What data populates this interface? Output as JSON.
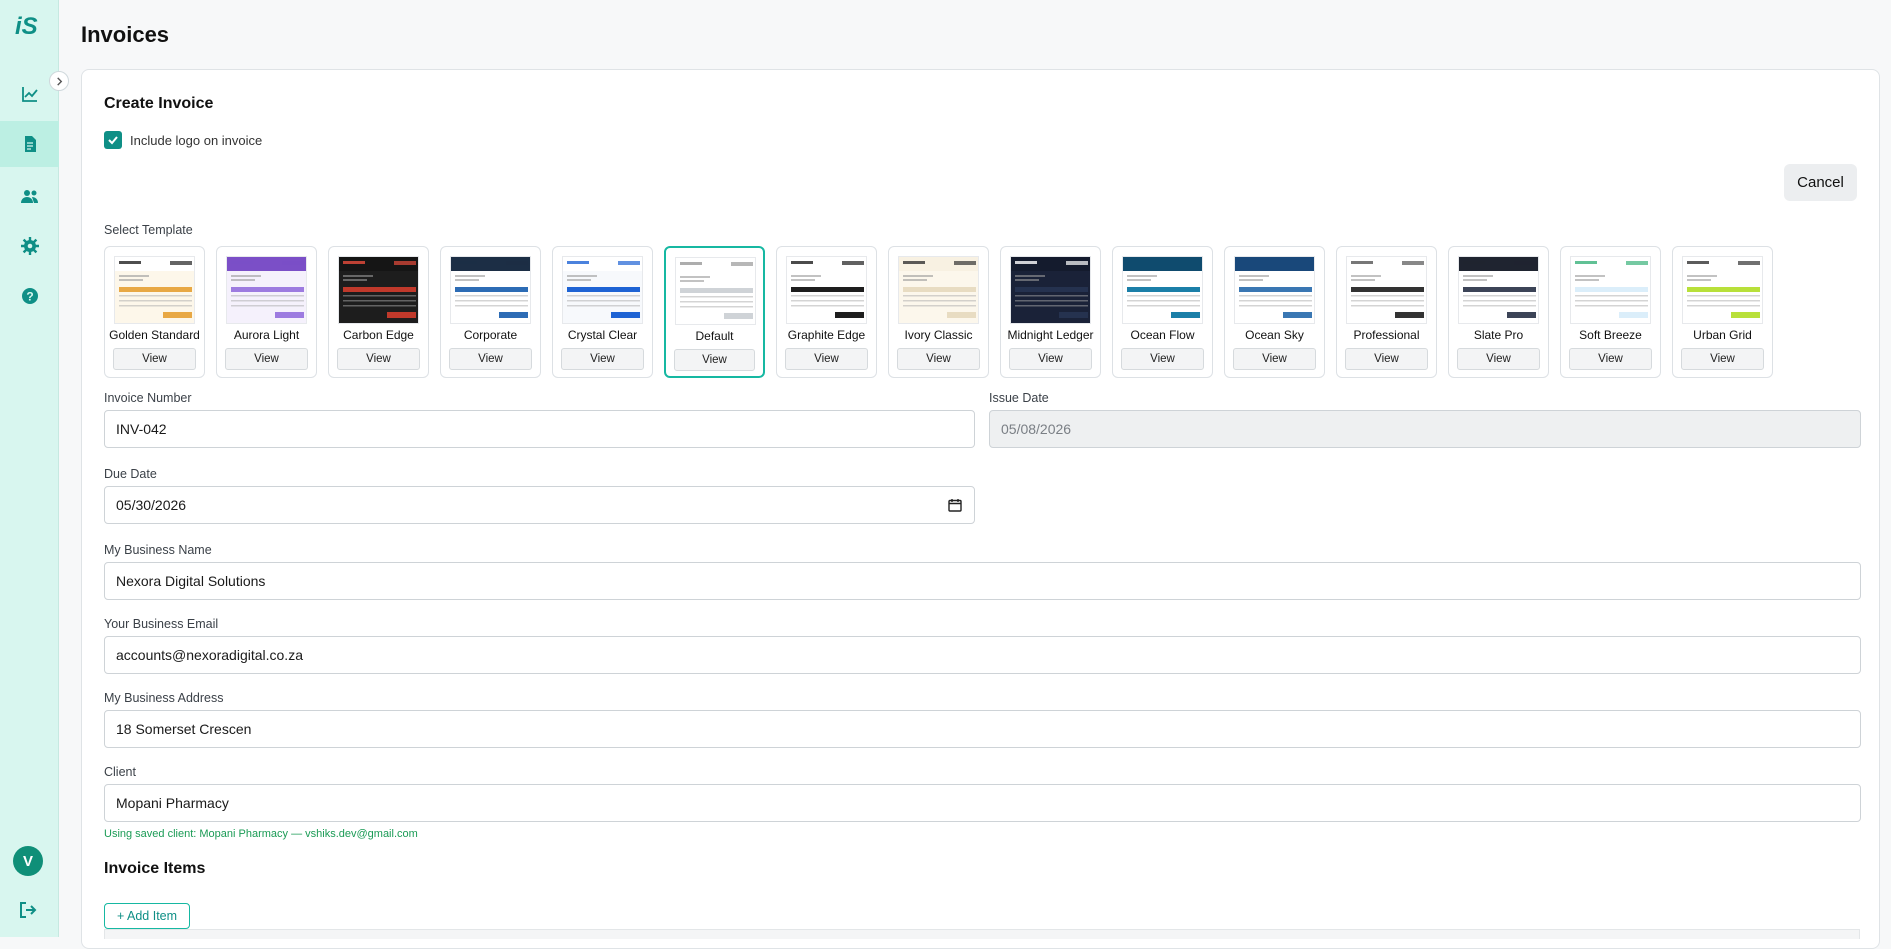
{
  "app": {
    "page_title": "Invoices",
    "logo_text": "iS"
  },
  "sidebar": {
    "icons": [
      "chart-icon",
      "invoice-icon",
      "users-icon",
      "gear-icon",
      "help-icon"
    ],
    "active_index": 1,
    "avatar_initial": "V"
  },
  "form": {
    "title": "Create Invoice",
    "include_logo_label": "Include logo on invoice",
    "include_logo_checked": true,
    "cancel_label": "Cancel",
    "template_label": "Select Template",
    "view_label": "View",
    "templates": [
      {
        "name": "Golden Standard",
        "style": "golden"
      },
      {
        "name": "Aurora Light",
        "style": "aurora"
      },
      {
        "name": "Carbon Edge",
        "style": "carbon"
      },
      {
        "name": "Corporate",
        "style": "corporate"
      },
      {
        "name": "Crystal Clear",
        "style": "crystal"
      },
      {
        "name": "Default",
        "style": "default"
      },
      {
        "name": "Graphite Edge",
        "style": "graphite"
      },
      {
        "name": "Ivory Classic",
        "style": "ivory"
      },
      {
        "name": "Midnight Ledger",
        "style": "midnight"
      },
      {
        "name": "Ocean Flow",
        "style": "oceanflow"
      },
      {
        "name": "Ocean Sky",
        "style": "oceansky"
      },
      {
        "name": "Professional",
        "style": "professional"
      },
      {
        "name": "Slate Pro",
        "style": "slate"
      },
      {
        "name": "Soft Breeze",
        "style": "breeze"
      },
      {
        "name": "Urban Grid",
        "style": "urban"
      }
    ],
    "selected_template": "Default",
    "invoice_number": {
      "label": "Invoice Number",
      "value": "INV-042"
    },
    "issue_date": {
      "label": "Issue Date",
      "value": "05/08/2026"
    },
    "due_date": {
      "label": "Due Date",
      "value": "05/30/2026"
    },
    "business_name": {
      "label": "My Business Name",
      "value": "Nexora Digital Solutions"
    },
    "business_email": {
      "label": "Your Business Email",
      "value": "accounts@nexoradigital.co.za"
    },
    "business_address": {
      "label": "My Business Address",
      "value": "18 Somerset Crescen"
    },
    "client": {
      "label": "Client",
      "value": "Mopani Pharmacy",
      "help": "Using saved client: Mopani Pharmacy — vshiks.dev@gmail.com"
    },
    "items_title": "Invoice Items",
    "add_item_label": "+ Add Item"
  },
  "colors": {
    "accent": "#16b8a2",
    "sidebar_bg": "#d8f6ef",
    "icon": "#0f8f86"
  }
}
